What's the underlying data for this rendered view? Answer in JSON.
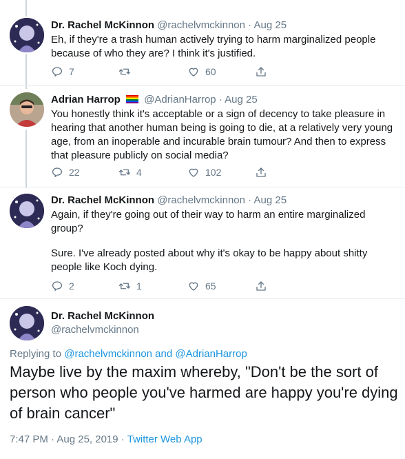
{
  "tweets": [
    {
      "name": "Dr. Rachel McKinnon",
      "handle": "@rachelvmckinnon",
      "dot": "·",
      "date": "Aug 25",
      "text": "Eh, if they're a trash human actively trying to harm marginalized people because of who they are? I think it's justified.",
      "replies": "7",
      "retweets": "",
      "likes": "60"
    },
    {
      "name": "Adrian Harrop",
      "handle": "@AdrianHarrop",
      "dot": "·",
      "date": "Aug 25",
      "text": "You honestly think it's acceptable or a sign of decency to take pleasure in hearing that another human being is going to die, at a relatively very young age, from an inoperable and incurable brain tumour? And then to express that pleasure publicly on social media?",
      "replies": "22",
      "retweets": "4",
      "likes": "102"
    },
    {
      "name": "Dr. Rachel McKinnon",
      "handle": "@rachelvmckinnon",
      "dot": "·",
      "date": "Aug 25",
      "text_p1": "Again, if they're going out of their way to harm an entire marginalized group?",
      "text_p2": "Sure. I've already posted about why it's okay to be happy about shitty people like Koch dying.",
      "replies": "2",
      "retweets": "1",
      "likes": "65"
    }
  ],
  "focused": {
    "name": "Dr. Rachel McKinnon",
    "handle": "@rachelvmckinnon",
    "replying_prefix": "Replying to",
    "reply_user1": "@rachelvmckinnon",
    "reply_and": "and",
    "reply_user2": "@AdrianHarrop",
    "text": "Maybe live by the maxim whereby, \"Don't be the sort of person who people you've harmed are happy you're dying of brain cancer\"",
    "time": "7:47 PM · Aug 25, 2019 ·",
    "source": "Twitter Web App"
  },
  "icons": {
    "reply": "reply-icon",
    "retweet": "retweet-icon",
    "like": "heart-icon",
    "share": "share-icon",
    "flag": "rainbow-flag-icon"
  },
  "colors": {
    "text": "#14171a",
    "muted": "#657786",
    "link": "#1b95e0",
    "divider": "#e6ecf0"
  }
}
